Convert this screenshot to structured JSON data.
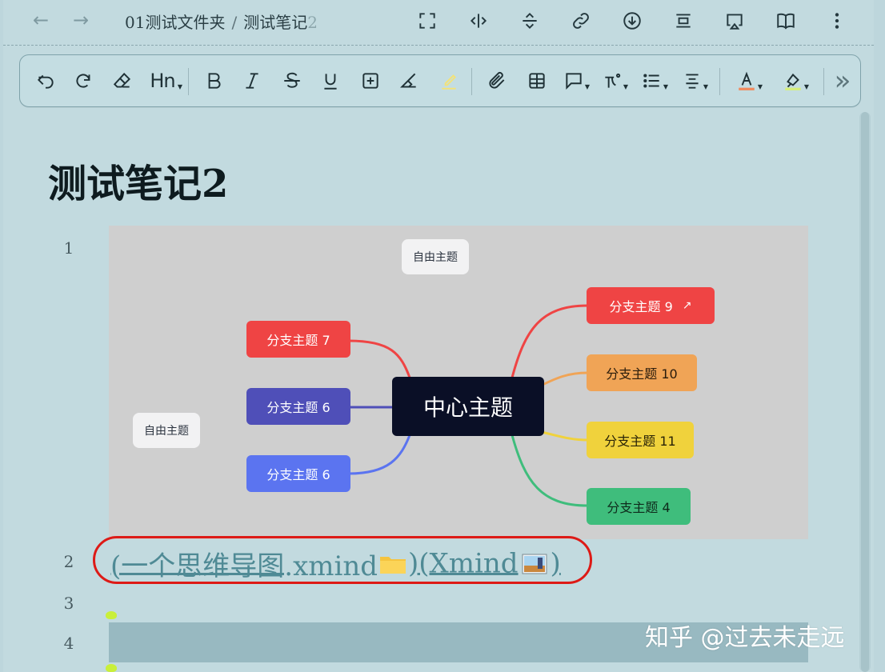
{
  "topbar": {
    "breadcrumb_folder": "01测试文件夹",
    "breadcrumb_sep": "/",
    "breadcrumb_note": "测试笔记",
    "breadcrumb_note_suffix": "2"
  },
  "toolbar": {
    "heading_label": "Hn",
    "more_label": "»"
  },
  "document": {
    "title": "测试笔记2",
    "line_numbers": [
      "1",
      "2",
      "3",
      "4"
    ]
  },
  "mindmap": {
    "center": "中心主题",
    "free_topic_1": "自由主题",
    "free_topic_2": "自由主题",
    "left_branches": [
      "分支主题 7",
      "分支主题 6",
      "分支主题 6"
    ],
    "right_branches": [
      "分支主题 9",
      "分支主题 10",
      "分支主题 11",
      "分支主题 4"
    ],
    "branch_colors": {
      "red": "#ef4444",
      "indigo": "#4f4fb8",
      "blue": "#5b74f0",
      "orange": "#f0a456",
      "yellow": "#f0d23c",
      "green": "#3fbd7c"
    }
  },
  "links": {
    "part1": "(一个思维导图.xmind",
    "part2": ")(Xmind",
    "part3": ")"
  },
  "watermark": "知乎 @过去未走远",
  "colors": {
    "background": "#c2dadf",
    "highlight_circle": "#dd1a16",
    "link": "#4f8a95"
  }
}
